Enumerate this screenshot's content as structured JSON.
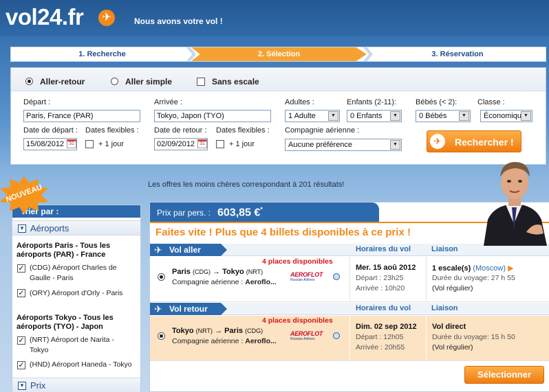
{
  "header": {
    "logo": "vol24.fr",
    "tagline": "Nous avons votre vol !"
  },
  "steps": [
    {
      "label": "1. Recherche",
      "active": false
    },
    {
      "label": "2. Sélection",
      "active": true
    },
    {
      "label": "3. Réservation",
      "active": false
    }
  ],
  "search": {
    "trip_types": [
      {
        "label": "Aller-retour",
        "selected": true
      },
      {
        "label": "Aller simple",
        "selected": false
      }
    ],
    "nonstop_label": "Sans escale",
    "depart_label": "Départ :",
    "depart_value": "Paris, France (PAR)",
    "arrivee_label": "Arrivée :",
    "arrivee_value": "Tokyo, Japon (TYO)",
    "date_depart_label": "Date de départ :",
    "date_depart_value": "15/08/2012",
    "date_retour_label": "Date de retour :",
    "date_retour_value": "02/09/2012",
    "flex_label": "Dates flexibles :",
    "flex_option": "+ 1 jour",
    "adultes_label": "Adultes :",
    "adultes_value": "1 Adulte",
    "enfants_label": "Enfants (2-11):",
    "enfants_value": "0 Enfants",
    "bebes_label": "Bébés (< 2):",
    "bebes_value": "0 Bébés",
    "classe_label": "Classe :",
    "classe_value": "Économique",
    "compagnie_label": "Compagnie aérienne :",
    "compagnie_value": "Aucune préférence",
    "search_button": "Rechercher !",
    "calendar_icon_text": "31"
  },
  "results_count": "Les offres les moins chères correspondant à  201 résultats!",
  "badge": "NOUVEAU",
  "sidebar": {
    "title": "Trier par :",
    "section_airports": "Aéroports",
    "group_paris": "Aéroports Paris - Tous les aéroports (PAR) - France",
    "paris_items": [
      "(CDG) Aéroport Charles de Gaulle - Paris",
      "(ORY) Aéroport d'Orly - Paris"
    ],
    "group_tokyo": "Aéroports Tokyo - Tous les aéroports (TYO) - Japon",
    "tokyo_items": [
      "(NRT) Aéroport de Narita - Tokyo",
      "(HND) Aéroport Haneda - Tokyo"
    ],
    "section_price": "Prix"
  },
  "offer": {
    "price_label": "Prix par pers. :",
    "price_value": "603,85 €",
    "price_star": "*",
    "hurry": "Faites vite ! Plus que 4 billets disponibles à ce prix !",
    "col_horaires": "Horaires du vol",
    "col_liaison": "Liaison",
    "places": "4 places disponibles",
    "airline_prefix": "Compagnie aérienne :",
    "airline_name": "Aeroflo...",
    "aeroflot_logo": "AEROFLOT",
    "aeroflot_sub": "Russian Airlines",
    "outbound": {
      "tab": "Vol aller",
      "from": "Paris",
      "from_code": "(CDG)",
      "arrow": "→",
      "to": "Tokyo",
      "to_code": "(NRT)",
      "date": "Mer. 15 aoû 2012",
      "depart": "Départ : 23h25",
      "arrivee": "Arrivée : 10h20",
      "liaison": "1 escale(s)",
      "via": "(Moscow)",
      "duree": "Durée du voyage: 27 h 55",
      "regulier": "(Vol régulier)"
    },
    "return": {
      "tab": "Vol retour",
      "from": "Tokyo",
      "from_code": "(NRT)",
      "arrow": "→",
      "to": "Paris",
      "to_code": "(CDG)",
      "date": "Dim. 02 sep 2012",
      "depart": "Départ : 12h05",
      "arrivee": "Arrivée : 20h55",
      "liaison": "Vol direct",
      "duree": "Durée du voyage: 15 h 50",
      "regulier": "(Vol régulier)"
    },
    "select_button": "Sélectionner"
  },
  "colors": {
    "brand_blue": "#2d6aad",
    "accent_orange": "#f28a1a",
    "alert_red": "#d4161b"
  }
}
